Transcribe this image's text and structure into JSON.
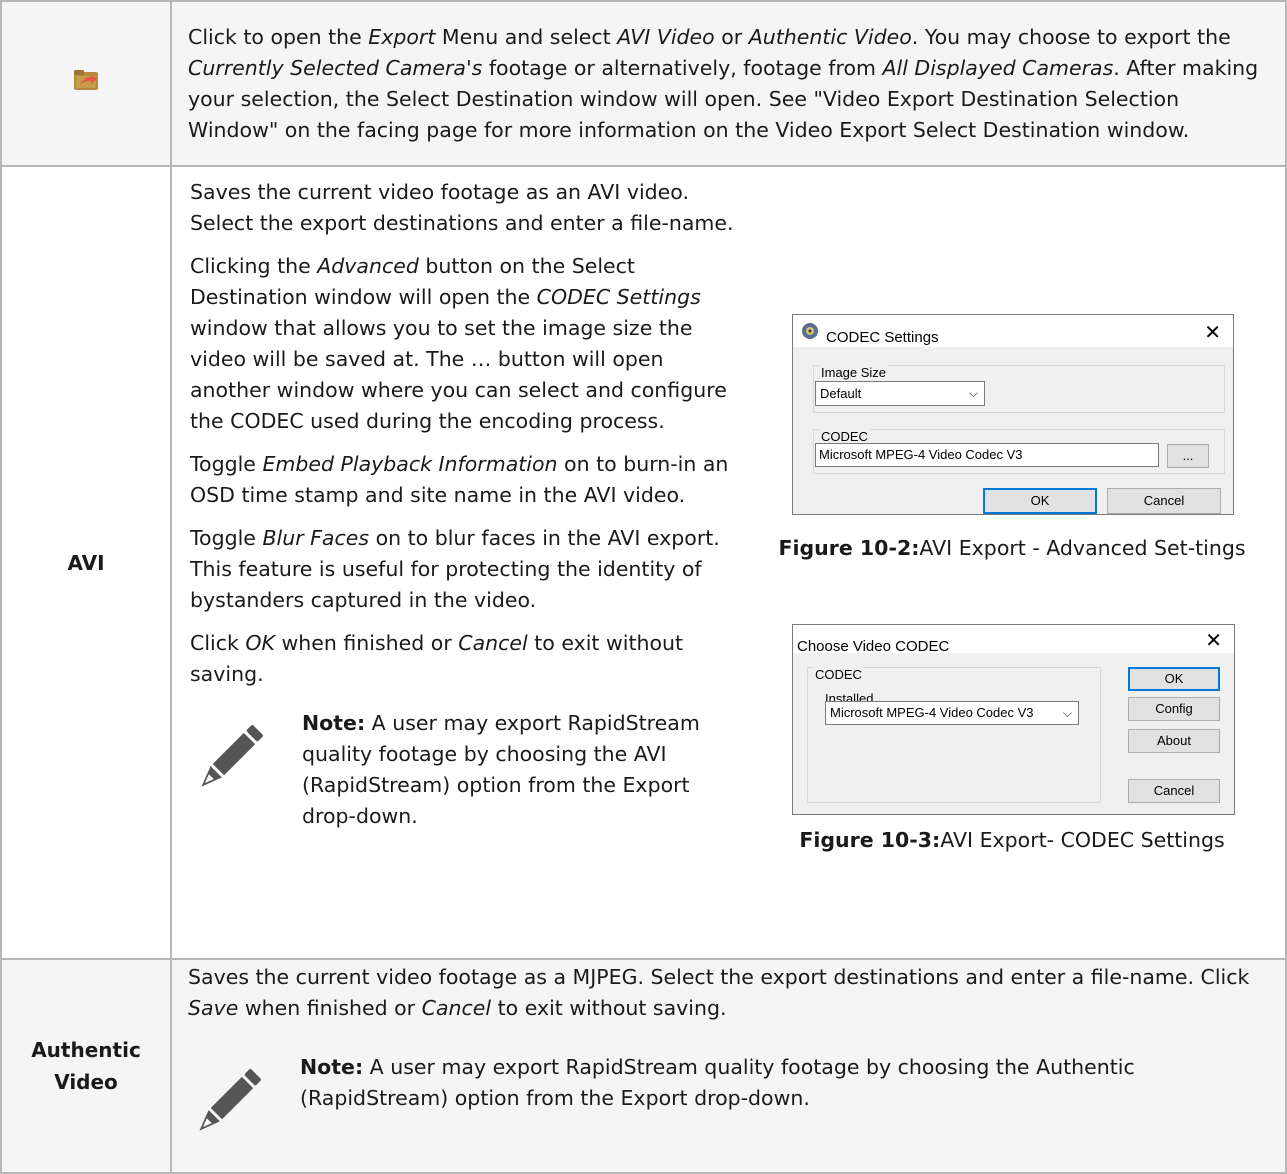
{
  "row_export": {
    "icon": "export-folder-icon",
    "text": [
      {
        "t": "Click to open the "
      },
      {
        "t": "Export",
        "i": true
      },
      {
        "t": " Menu and select "
      },
      {
        "t": "AVI Video",
        "i": true
      },
      {
        "t": " or "
      },
      {
        "t": "Authentic Video",
        "i": true
      },
      {
        "t": ". You may choose to export the "
      },
      {
        "t": "Currently Selected Camera's",
        "i": true
      },
      {
        "t": " footage or alternatively, footage from "
      },
      {
        "t": "All Displayed Cameras",
        "i": true
      },
      {
        "t": ".  After making your selection, the Select Destination window will open. See \"Video Export Destination Selection Window\" on the facing page for more information on the Video Export Select Destination window."
      }
    ]
  },
  "row_avi": {
    "label": "AVI",
    "paragraphs": [
      [
        {
          "t": "Saves the current video footage as an AVI video. Select the export destinations and enter a file-name."
        }
      ],
      [
        {
          "t": "Clicking the "
        },
        {
          "t": "Advanced",
          "i": true
        },
        {
          "t": " button on the Select Destination window will open the "
        },
        {
          "t": "CODEC Settings",
          "i": true
        },
        {
          "t": " window that allows you to set the image size the video will be saved at.  The … button will open another window where you can select and configure the CODEC used during the encoding process."
        }
      ],
      [
        {
          "t": "Toggle "
        },
        {
          "t": "Embed Playback Information",
          "i": true
        },
        {
          "t": " on to burn-in an OSD time stamp and site name in the AVI video."
        }
      ],
      [
        {
          "t": "Toggle "
        },
        {
          "t": "Blur Faces",
          "i": true
        },
        {
          "t": " on to blur faces in the AVI export. This feature is useful for protecting the identity of bystanders captured in the video."
        }
      ],
      [
        {
          "t": "Click "
        },
        {
          "t": "OK",
          "i": true
        },
        {
          "t": " when finished or "
        },
        {
          "t": "Cancel",
          "i": true
        },
        {
          "t": " to exit without saving."
        }
      ]
    ],
    "note_label": "Note:",
    "note_text": " A user may export RapidStream quality footage by choosing the AVI (RapidStream) option from the Export drop-down.",
    "codec_dialog": {
      "title": "CODEC Settings",
      "close": "✕",
      "image_size_label": "Image Size",
      "image_size_value": "Default",
      "codec_label": "CODEC",
      "codec_value": "Microsoft MPEG-4 Video Codec V3",
      "browse": "...",
      "ok": "OK",
      "cancel": "Cancel"
    },
    "figure1_label": "Figure 10-2:",
    "figure1_text": "AVI Export - Advanced Set-tings",
    "choose_dialog": {
      "title": "Choose Video CODEC",
      "close": "✕",
      "codec_label": "CODEC",
      "installed_label": "Installed",
      "installed_value": "Microsoft MPEG-4 Video Codec V3",
      "ok": "OK",
      "config": "Config",
      "about": "About",
      "cancel": "Cancel"
    },
    "figure2_label": "Figure 10-3:",
    "figure2_text": "AVI Export- CODEC Settings"
  },
  "row_authentic": {
    "label_line1": "Authentic",
    "label_line2": "Video",
    "paragraph": [
      {
        "t": "Saves the current video footage as a MJPEG. Select the export destinations and enter a file-name. Click "
      },
      {
        "t": "Save",
        "i": true
      },
      {
        "t": " when finished or "
      },
      {
        "t": "Cancel",
        "i": true
      },
      {
        "t": " to exit without saving."
      }
    ],
    "note_label": "Note:",
    "note_text": " A user may export RapidStream quality footage by choosing the Authentic (RapidStream) option from the Export drop-down."
  }
}
